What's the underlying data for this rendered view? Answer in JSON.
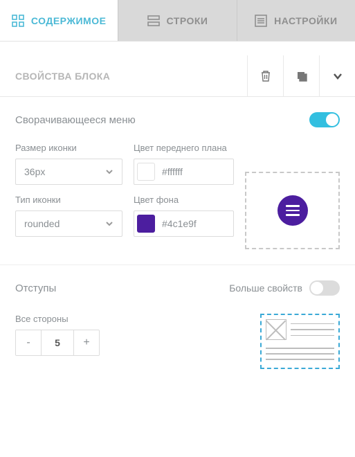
{
  "tabs": {
    "content": "СОДЕРЖИМОЕ",
    "rows": "СТРОКИ",
    "settings": "НАСТРОЙКИ"
  },
  "block": {
    "title": "СВОЙСТВА БЛОКА"
  },
  "menu": {
    "collapsible_label": "Сворачивающееся меню",
    "collapsible_on": true,
    "icon_size_label": "Размер иконки",
    "icon_size_value": "36px",
    "icon_type_label": "Тип иконки",
    "icon_type_value": "rounded",
    "fg_label": "Цвет переднего плана",
    "fg_value": "#ffffff",
    "bg_label": "Цвет фона",
    "bg_value": "#4c1e9f"
  },
  "padding": {
    "title": "Отступы",
    "more_label": "Больше свойств",
    "more_on": false,
    "all_sides_label": "Все стороны",
    "all_sides_value": "5"
  }
}
